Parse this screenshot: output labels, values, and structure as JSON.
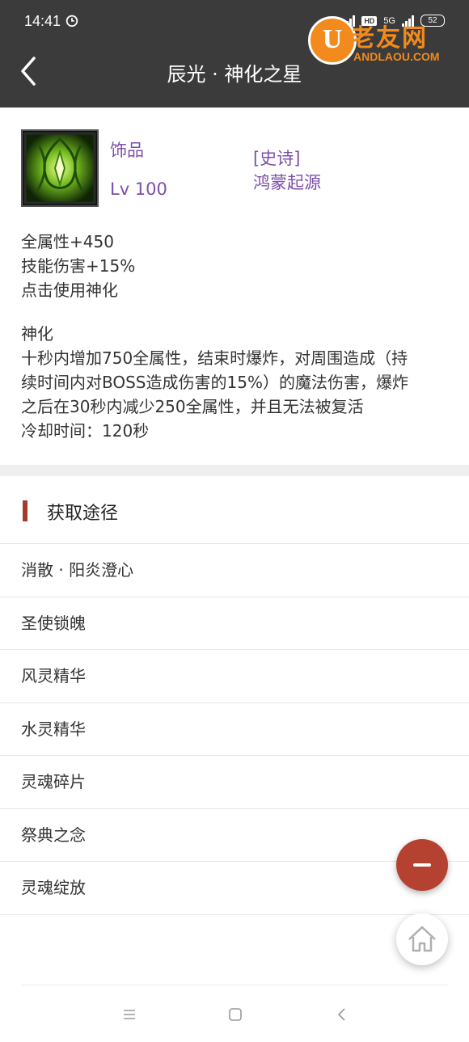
{
  "status_bar": {
    "time": "14:41",
    "network_1": "4G",
    "hd_label": "HD",
    "network_2": "5G",
    "battery": "52"
  },
  "watermark": {
    "logo_letter": "U",
    "title": "老友网",
    "subtitle": "ANDLAOU.COM"
  },
  "header": {
    "title": "辰光 · 神化之星"
  },
  "item": {
    "type": "饰品",
    "level": "Lv 100",
    "rarity": "[史诗]",
    "set_name": "鸿蒙起源",
    "stats": [
      "全属性+450",
      "技能伤害+15%",
      "点击使用神化"
    ],
    "skill": {
      "name": "神化",
      "desc_lines": [
        "十秒内增加750全属性，结束时爆炸，对周围造成（持",
        "续时间内对BOSS造成伤害的15%）的魔法伤害，爆炸",
        "之后在30秒内减少250全属性，并且无法被复活"
      ],
      "cooldown": "冷却时间：120秒"
    }
  },
  "sources": {
    "title": "获取途径",
    "items": [
      "消散 · 阳炎澄心",
      "圣使锁魄",
      "风灵精华",
      "水灵精华",
      "灵魂碎片",
      "祭典之念",
      "灵魂绽放"
    ]
  },
  "colors": {
    "header_bg": "#3b3b3b",
    "accent": "#b54230",
    "item_text": "#7d4fa8",
    "watermark": "#f28a1d"
  },
  "icons": {
    "back": "chevron-left-icon",
    "alarm": "alarm-clock-icon",
    "fab_minus": "minus-icon",
    "fab_home": "home-icon",
    "nav_menu": "menu-icon",
    "nav_home": "square-home-icon",
    "nav_back": "nav-back-icon"
  }
}
